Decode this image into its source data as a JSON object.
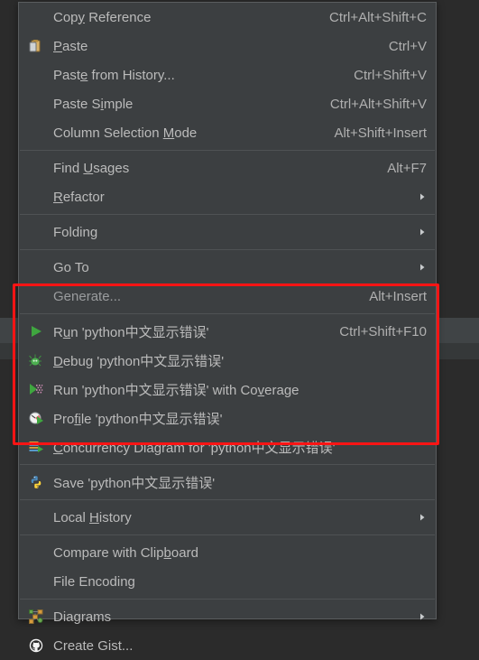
{
  "window": {
    "background_color": "#2b2b2b",
    "menu_background_color": "#3c3f41",
    "menu_text_color": "#bbbbbb",
    "highlight_box_color": "#ff1414"
  },
  "context_menu": {
    "name": "editor-context-menu",
    "groups": [
      {
        "items": [
          {
            "label": "Copy Reference",
            "mnemonic": "y",
            "accel": "Ctrl+Alt+Shift+C",
            "icon": "",
            "submenu": false
          },
          {
            "label": "Paste",
            "mnemonic": "P",
            "accel": "Ctrl+V",
            "icon": "paste-icon",
            "submenu": false
          },
          {
            "label": "Paste from History...",
            "mnemonic": "e",
            "accel": "Ctrl+Shift+V",
            "icon": "",
            "submenu": false
          },
          {
            "label": "Paste Simple",
            "mnemonic": "i",
            "accel": "Ctrl+Alt+Shift+V",
            "icon": "",
            "submenu": false
          },
          {
            "label": "Column Selection Mode",
            "mnemonic": "M",
            "accel": "Alt+Shift+Insert",
            "icon": "",
            "submenu": false
          }
        ]
      },
      {
        "items": [
          {
            "label": "Find Usages",
            "mnemonic": "U",
            "accel": "Alt+F7",
            "icon": "",
            "submenu": false
          },
          {
            "label": "Refactor",
            "mnemonic": "R",
            "accel": "",
            "icon": "",
            "submenu": true
          }
        ]
      },
      {
        "items": [
          {
            "label": "Folding",
            "mnemonic": "",
            "accel": "",
            "icon": "",
            "submenu": true
          }
        ]
      },
      {
        "items": [
          {
            "label": "Go To",
            "mnemonic": "",
            "accel": "",
            "icon": "",
            "submenu": true
          },
          {
            "label": "Generate...",
            "mnemonic": "",
            "accel": "Alt+Insert",
            "icon": "",
            "submenu": false,
            "clipped": true
          }
        ]
      },
      {
        "items": [
          {
            "label": "Run 'python中文显示错误'",
            "mnemonic": "u",
            "accel": "Ctrl+Shift+F10",
            "icon": "run-icon",
            "submenu": false
          },
          {
            "label": "Debug 'python中文显示错误'",
            "mnemonic": "D",
            "accel": "",
            "icon": "debug-icon",
            "submenu": false
          },
          {
            "label": "Run 'python中文显示错误' with Coverage",
            "mnemonic": "v",
            "accel": "",
            "icon": "coverage-icon",
            "submenu": false
          },
          {
            "label": "Profile 'python中文显示错误'",
            "mnemonic": "fi",
            "accel": "",
            "icon": "profile-icon",
            "submenu": false
          },
          {
            "label": "Concurrency Diagram for  'python中文显示错误'",
            "mnemonic": "C",
            "accel": "",
            "icon": "concurrency-diagram-icon",
            "submenu": false
          }
        ]
      },
      {
        "items": [
          {
            "label": "Save 'python中文显示错误'",
            "mnemonic": "",
            "accel": "",
            "icon": "python-file-icon",
            "submenu": false
          }
        ]
      },
      {
        "items": [
          {
            "label": "Local History",
            "mnemonic": "H",
            "accel": "",
            "icon": "",
            "submenu": true
          }
        ]
      },
      {
        "items": [
          {
            "label": "Compare with Clipboard",
            "mnemonic": "b",
            "accel": "",
            "icon": "",
            "submenu": false
          },
          {
            "label": "File Encoding",
            "mnemonic": "",
            "accel": "",
            "icon": "",
            "submenu": false
          }
        ]
      },
      {
        "items": [
          {
            "label": "Diagrams",
            "mnemonic": "",
            "accel": "",
            "icon": "diagrams-icon",
            "submenu": true
          },
          {
            "label": "Create Gist...",
            "mnemonic": "",
            "accel": "",
            "icon": "github-icon",
            "submenu": false
          }
        ]
      }
    ]
  },
  "annotation": {
    "highlight_rectangle_label": "run-configuration-actions-highlight"
  }
}
